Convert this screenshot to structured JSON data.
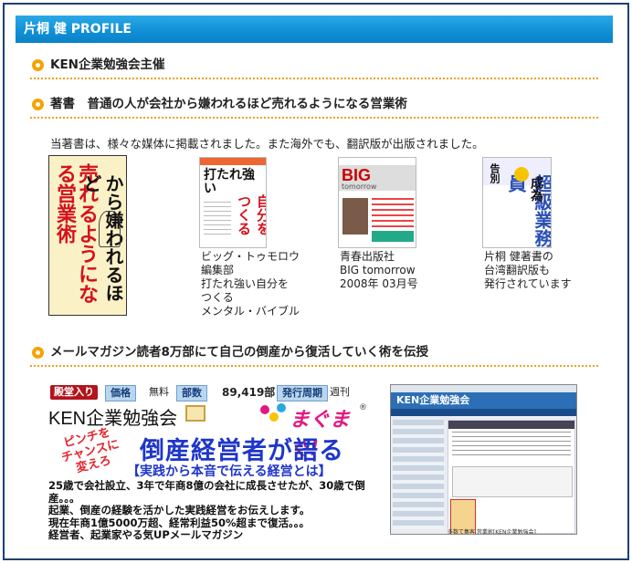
{
  "header": {
    "title": "片桐 健 PROFILE"
  },
  "sections": {
    "s1": "KEN企業勉強会主催",
    "s2": "著書　普通の人が会社から嫌われるほど売れるようになる営業術",
    "s3": "メールマガジン読者8万部にて自己の倒産から復活していく術を伝授"
  },
  "intro": "当著書は、様々な媒体に掲載されました。また海外でも、翻訳版が出版されました。",
  "books": [
    {
      "caption": "",
      "cover_red_text": "売れるようになる営業術",
      "cover_black_text": "普通の人が会社から嫌われるほど"
    },
    {
      "caption": "ビッグ・トゥモロウ\n編集部\n打たれ強い自分を\nつくる\nメンタル・バイブル",
      "cover_text1": "打たれ強い",
      "cover_text2": "自分をつくる"
    },
    {
      "caption": "青春出版社\nBIG tomorrow\n2008年 03月号",
      "cover_big": "BIG",
      "cover_sub": "tomorrow"
    },
    {
      "caption": "片桐 健著書の\n台湾翻訳版も\n発行されています",
      "cover_v1": "告別",
      "cover_v2": "超級業務員",
      "cover_v3": "成為"
    }
  ],
  "magazine": {
    "hall_label": "殿堂入り",
    "price_label": "価格",
    "price_value": "無料",
    "count_label": "部数",
    "count_value": "89,419部",
    "cycle_label": "発行周期",
    "cycle_value": "週刊",
    "ken_title": "KEN企業勉強会",
    "logo": "まぐまぐ!",
    "logo_mark": "®",
    "pinch": "ピンチを\nチャンスに\n変えろ",
    "big_title": "倒産経営者が語る",
    "sub_title": "【実践から本音で伝える経営とは】",
    "description": "25歳で会社設立、3年で年商8億の会社に成長させたが、30歳で倒産。。。\n起業、倒産の経験を活かした実践経営をお伝えします。\n現在年商1億5000万超、経常利益50%超まで復活。。。\n経営者、起業家やる気UPメールマガジン"
  },
  "screenshot": {
    "banner": "KEN企業勉強会",
    "footer": "多数て集客 営業術[KEN企業勉強会]"
  },
  "colors": {
    "header_blue": "#0f8fd6",
    "frame_navy": "#1f3f73",
    "bullet_orange": "#f5a300",
    "title_blue": "#1e36c9",
    "accent_red": "#e3262e"
  }
}
